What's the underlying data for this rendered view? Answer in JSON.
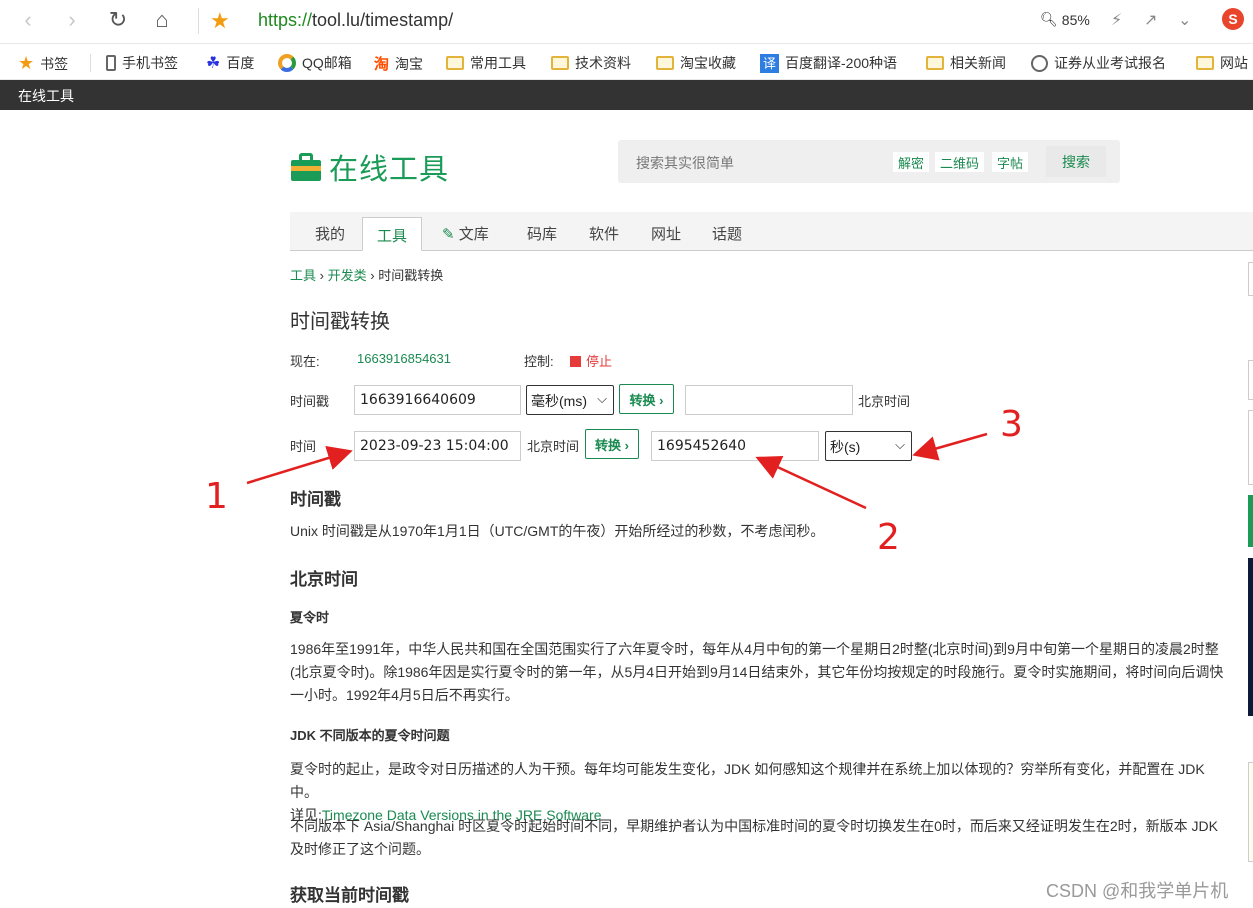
{
  "browser": {
    "url_host": "https://",
    "url_domain": "tool.lu/timestamp/",
    "zoom": "85%",
    "bookmarks": [
      {
        "label": "书签"
      },
      {
        "label": "手机书签"
      },
      {
        "label": "百度"
      },
      {
        "label": "QQ邮箱"
      },
      {
        "label": "淘宝"
      },
      {
        "label": "常用工具"
      },
      {
        "label": "技术资料"
      },
      {
        "label": "淘宝收藏"
      },
      {
        "label": "百度翻译-200种语"
      },
      {
        "label": "相关新闻"
      },
      {
        "label": "证券从业考试报名"
      },
      {
        "label": "网站"
      }
    ]
  },
  "site_bar": {
    "title": "在线工具"
  },
  "header": {
    "logo_text": "在线工具",
    "search_placeholder": "搜索其实很简单",
    "search_tags": [
      "解密",
      "二维码",
      "字帖"
    ],
    "search_button": "搜索"
  },
  "tabs": [
    "我的",
    "工具",
    "文库",
    "码库",
    "软件",
    "网址",
    "话题"
  ],
  "breadcrumb": {
    "item1": "工具",
    "sep1": "›",
    "item2": "开发类",
    "sep2": "›",
    "current": "时间戳转换"
  },
  "tool": {
    "title": "时间戳转换",
    "now_label": "现在:",
    "now_value": "1663916854631",
    "control_label": "控制:",
    "stop_label": "停止",
    "row1": {
      "label": "时间戳",
      "input_value": "1663916640609",
      "unit": "毫秒(ms)",
      "button": "转换 ›",
      "output_value": "",
      "suffix": "北京时间"
    },
    "row2": {
      "label": "时间",
      "input_value": "2023-09-23 15:04:00",
      "mid_label": "北京时间",
      "button": "转换 ›",
      "output_value": "1695452640",
      "unit": "秒(s)"
    }
  },
  "annotations": {
    "n1": "1",
    "n2": "2",
    "n3": "3"
  },
  "content": {
    "h_timestamp": "时间戳",
    "p_timestamp": "Unix 时间戳是从1970年1月1日（UTC/GMT的午夜）开始所经过的秒数，不考虑闰秒。",
    "h_beijing": "北京时间",
    "h_dst": "夏令时",
    "p_dst": "1986年至1991年，中华人民共和国在全国范围实行了六年夏令时，每年从4月中旬的第一个星期日2时整(北京时间)到9月中旬第一个星期日的凌晨2时整(北京夏令时)。除1986年因是实行夏令时的第一年，从5月4日开始到9月14日结束外，其它年份均按规定的时段施行。夏令时实施期间，将时间向后调快一小时。1992年4月5日后不再实行。",
    "h_jdk": "JDK 不同版本的夏令时问题",
    "p_jdk": "夏令时的起止，是政令对日历描述的人为干预。每年均可能发生变化，JDK 如何感知这个规律并在系统上加以体现的？穷举所有变化，并配置在 JDK 中。",
    "p_jdk_detail_prefix": "详见:",
    "p_jdk_link": "Timezone Data Versions in the JRE Software",
    "p_shanghai": "不同版本下 Asia/Shanghai 时区夏令时起始时间不同，早期维护者认为中国标准时间的夏令时切换发生在0时，而后来又经证明发生在2时，新版本 JDK 及时修正了这个问题。",
    "h_get_now": "获取当前时间戳"
  },
  "watermark": "CSDN @和我学单片机",
  "colors": {
    "brand_green": "#1a9b57",
    "link_green": "#1a8a50",
    "annotation_red": "#e32020",
    "stop_red": "#e53b3b"
  }
}
